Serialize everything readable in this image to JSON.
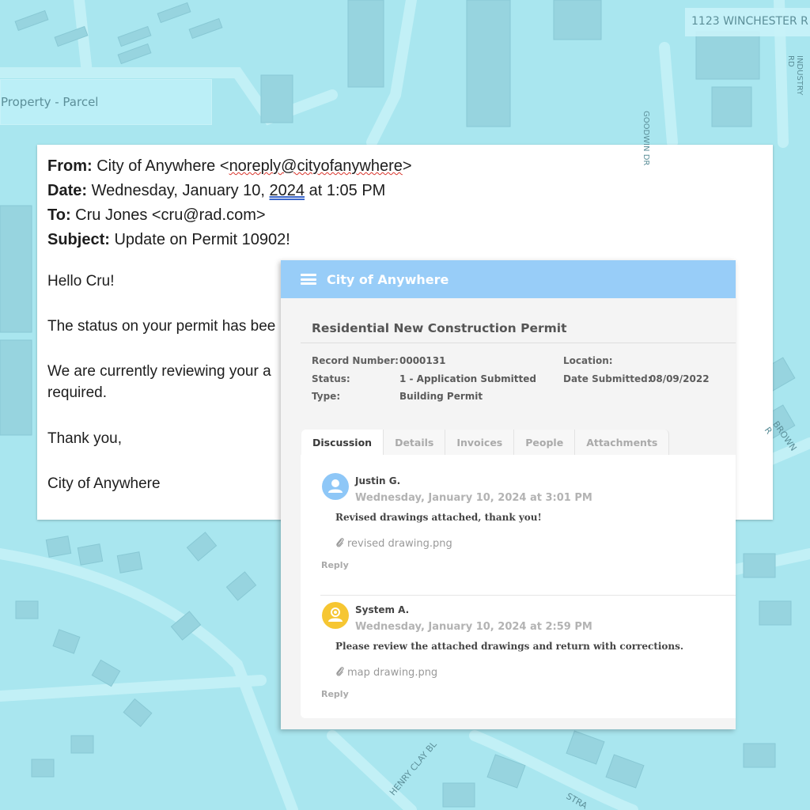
{
  "map": {
    "parcel_label": "Property - Parcel",
    "address_label": "1123 WINCHESTER R",
    "street_labels": [
      "GOODWIN DR",
      "INDUSTRY RD",
      "BROWN R",
      "HENRY CLAY BL",
      "STRA"
    ]
  },
  "email": {
    "from_label": "From:",
    "from_name": "City of Anywhere",
    "from_address": "noreply@cityofanywhere",
    "date_label": "Date:",
    "date_prefix": "Wednesday, January 10,",
    "date_year": "2024",
    "date_suffix": "at 1:05 PM",
    "to_label": "To:",
    "to_value": "Cru Jones <cru@rad.com>",
    "subject_label": "Subject:",
    "subject_value": "Update on Permit 10902!",
    "greeting": "Hello Cru!",
    "line1": "The status on your permit has bee",
    "line2a": "We are currently reviewing your a",
    "line2b": "required.",
    "signoff": "Thank you,",
    "signature": "City of Anywhere"
  },
  "portal": {
    "app_title": "City of Anywhere",
    "menu_icon": "hamburger-menu-icon",
    "permit_title": "Residential New Construction Permit",
    "fields": {
      "record_label": "Record Number:",
      "record_value": "0000131",
      "status_label": "Status:",
      "status_value": "1 - Application Submitted",
      "type_label": "Type:",
      "type_value": "Building Permit",
      "location_label": "Location:",
      "date_label": "Date Submitted:",
      "date_value": "08/09/2022"
    },
    "tabs": [
      "Discussion",
      "Details",
      "Invoices",
      "People",
      "Attachments"
    ],
    "active_tab": "Discussion",
    "comments": [
      {
        "author": "Justin G.",
        "date": "Wednesday, January 10, 2024 at 3:01 PM",
        "message": "Revised drawings attached, thank you!",
        "attachment": "revised drawing.png",
        "reply": "Reply",
        "avatar_color": "#8ec7f7",
        "avatar_icon": "user-icon"
      },
      {
        "author": "System A.",
        "date": "Wednesday, January 10, 2024 at 2:59 PM",
        "message": "Please review the attached drawings and return with corrections.",
        "attachment": "map drawing.png",
        "reply": "Reply",
        "avatar_color": "#f6c632",
        "avatar_icon": "system-user-icon"
      }
    ]
  },
  "colors": {
    "map_background": "#a9e6ef",
    "portal_header": "#98cdf8",
    "email_background": "#ffffff"
  }
}
